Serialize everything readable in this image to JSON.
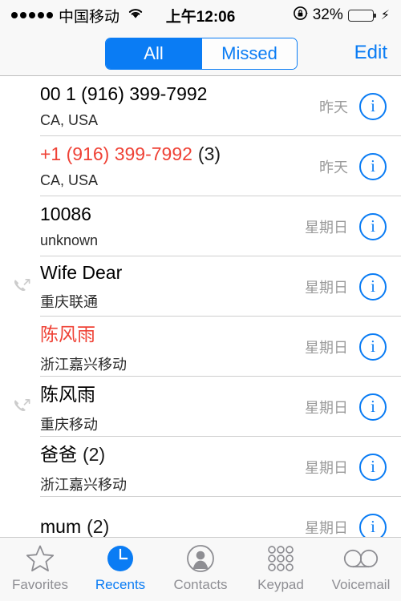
{
  "status_bar": {
    "signal_dots": 5,
    "carrier": "中国移动",
    "wifi_icon": "wifi-icon",
    "time": "上午12:06",
    "rotation_lock_icon": "rotation-lock-icon",
    "battery_percent": "32%",
    "battery_level": 32,
    "battery_color": "#4cd964",
    "charging_icon": "lightning-bolt-icon"
  },
  "nav_bar": {
    "segments": [
      {
        "label": "All",
        "selected": true
      },
      {
        "label": "Missed",
        "selected": false
      }
    ],
    "edit_label": "Edit",
    "accent_color": "#0a7cf4"
  },
  "call_list": {
    "missed_color": "#ef4236",
    "rows": [
      {
        "title": "00 1 (916) 399-7992",
        "count": "",
        "subtitle": "CA, USA",
        "time": "昨天",
        "missed": false,
        "direction_icon": "",
        "info_label": "i"
      },
      {
        "title": "+1 (916) 399-7992",
        "count": "(3)",
        "subtitle": "CA, USA",
        "time": "昨天",
        "missed": true,
        "direction_icon": "",
        "info_label": "i"
      },
      {
        "title": "10086",
        "count": "",
        "subtitle": "unknown",
        "time": "星期日",
        "missed": false,
        "direction_icon": "",
        "info_label": "i"
      },
      {
        "title": "Wife Dear",
        "count": "",
        "subtitle": "重庆联通",
        "time": "星期日",
        "missed": false,
        "direction_icon": "outgoing-call-icon",
        "info_label": "i"
      },
      {
        "title": "陈风雨",
        "count": "",
        "subtitle": "浙江嘉兴移动",
        "time": "星期日",
        "missed": true,
        "direction_icon": "",
        "info_label": "i"
      },
      {
        "title": "陈风雨",
        "count": "",
        "subtitle": "重庆移动",
        "time": "星期日",
        "missed": false,
        "direction_icon": "outgoing-call-icon",
        "info_label": "i"
      },
      {
        "title": "爸爸",
        "count": "(2)",
        "subtitle": "浙江嘉兴移动",
        "time": "星期日",
        "missed": false,
        "direction_icon": "",
        "info_label": "i"
      },
      {
        "title": "mum",
        "count": "(2)",
        "subtitle": "",
        "time": "星期日",
        "missed": false,
        "direction_icon": "",
        "info_label": "i"
      }
    ]
  },
  "tab_bar": {
    "active_color": "#0a7cf4",
    "inactive_color": "#8e8e93",
    "tabs": [
      {
        "label": "Favorites",
        "icon": "star-icon",
        "active": false
      },
      {
        "label": "Recents",
        "icon": "clock-icon",
        "active": true
      },
      {
        "label": "Contacts",
        "icon": "person-icon",
        "active": false
      },
      {
        "label": "Keypad",
        "icon": "keypad-dots-icon",
        "active": false
      },
      {
        "label": "Voicemail",
        "icon": "voicemail-icon",
        "active": false
      }
    ]
  }
}
